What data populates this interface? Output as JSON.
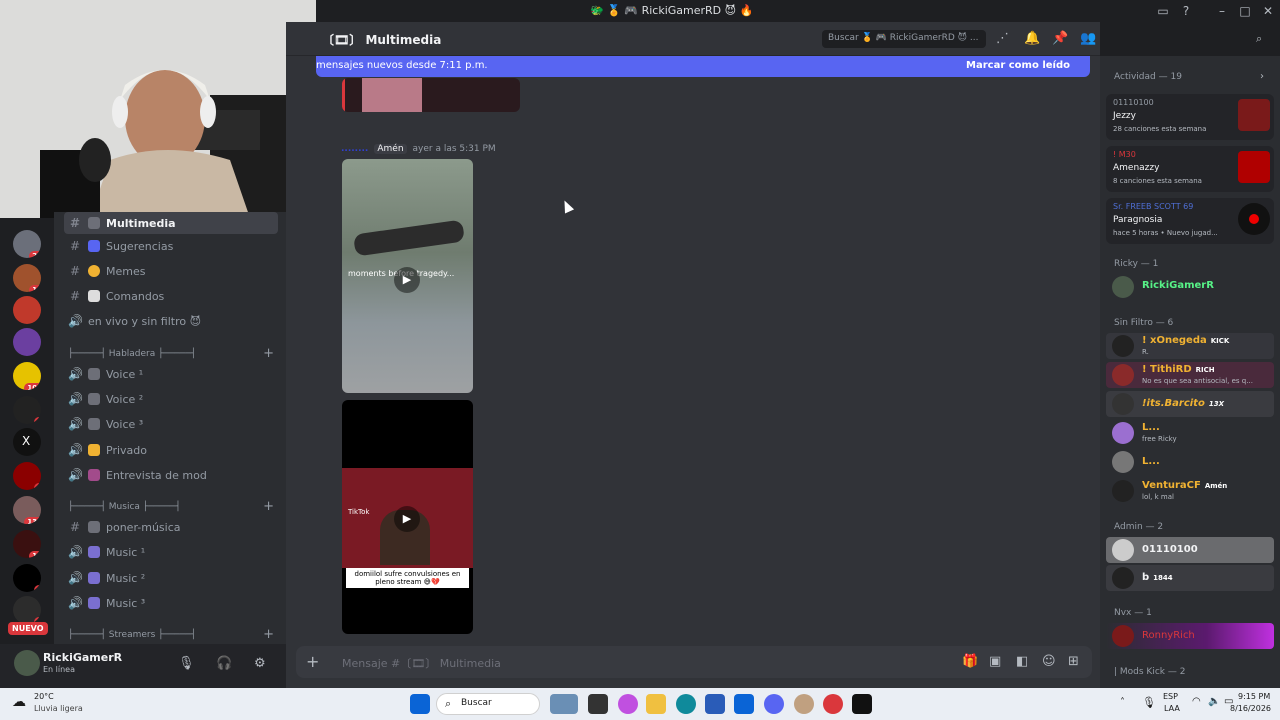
{
  "titlebar": {
    "title": "🐲 🏅 🎮 RickiGamerRD 😈 🔥",
    "icons": [
      "inbox-icon",
      "help-icon",
      "minimize-icon",
      "maximize-icon",
      "close-icon"
    ]
  },
  "channel": {
    "name": "Multimedia",
    "prefix": "〔🎞〕"
  },
  "header": {
    "search_placeholder": "Buscar 🏅 🎮 RickiGamerRD 😈 ..."
  },
  "new_messages": {
    "text": "mensajes nuevos desde 7:11 p.m.",
    "mark_read": "Marcar como leído"
  },
  "message": {
    "author": "........",
    "tag": "Amén",
    "time": "ayer a las 5:31 PM"
  },
  "media": {
    "video1_caption": "moments before tragedy...",
    "video2_caption": "domiilol sufre convulsiones en pleno stream 😅💔",
    "tiktok": "TikTok"
  },
  "composer": {
    "placeholder_prefix": "Mensaje #〔🎞〕",
    "placeholder_channel": "Multimedia"
  },
  "sidebar": {
    "channels": [
      {
        "label": "Multimedia",
        "icon": "#",
        "active": true
      },
      {
        "label": "Sugerencias",
        "icon": "#"
      },
      {
        "label": "Memes",
        "icon": "#"
      },
      {
        "label": "Comandos",
        "icon": "#"
      },
      {
        "label": "en vivo y sin filtro 😈",
        "icon": "🔊"
      }
    ],
    "cat_habladera": "├─────┤ Habladera ├─────┤",
    "voice": [
      {
        "label": "Voice ¹"
      },
      {
        "label": "Voice ²"
      },
      {
        "label": "Voice ³"
      },
      {
        "label": "Privado"
      },
      {
        "label": "Entrevista de mod"
      }
    ],
    "cat_musica": "├─────┤ Musica ├─────┤",
    "musica": [
      {
        "label": "poner-música",
        "icon": "#"
      },
      {
        "label": "Music ¹",
        "icon": "🔊"
      },
      {
        "label": "Music ²",
        "icon": "🔊"
      },
      {
        "label": "Music ³",
        "icon": "🔊"
      }
    ],
    "cat_streamers": "├─────┤ Streamers ├─────┤",
    "guild_badges": [
      "20",
      "12",
      "109",
      "9",
      "2",
      "134",
      "13",
      "8",
      "3"
    ],
    "nuevo": "NUEVO"
  },
  "user": {
    "name": "RickiGamerR",
    "status": "En línea"
  },
  "members": {
    "activity_header": "Actividad — 19",
    "activities": [
      {
        "game": "01110100",
        "name": "Jezzy",
        "sub": "28 canciones esta semana"
      },
      {
        "game": "! M30",
        "name": "Amenazzy",
        "sub": "8 canciones esta semana"
      },
      {
        "game": "Sr. FREEB SCOTT 69",
        "name": "Paragnosia",
        "sub": "hace 5 horas  •  Nuevo jugad..."
      }
    ],
    "ricky_header": "Ricky — 1",
    "ricky": [
      {
        "name": "RickiGamerR"
      }
    ],
    "sinfiltro_header": "Sin Filtro — 6",
    "sinfiltro": [
      {
        "name": "! xOnegeda",
        "badge": "KICK",
        "sub": "R.",
        "color": "#f0b232"
      },
      {
        "name": "! TithiRD",
        "badge": "RICH",
        "sub": "No es que sea antisocial, es q...",
        "color": "#f0b232"
      },
      {
        "name": "!its.Barcito",
        "badge": "13X",
        "sub": "",
        "color": "#f0b232"
      },
      {
        "name": "L...",
        "badge": "",
        "sub": "free Ricky",
        "color": "#f0b232"
      },
      {
        "name": "L...",
        "badge": "",
        "sub": "",
        "color": "#f0b232"
      },
      {
        "name": "VenturaCF",
        "badge": "Amén",
        "sub": "lol, k mal",
        "color": "#f0b232"
      }
    ],
    "admin_header": "Admin — 2",
    "admin": [
      {
        "name": "01110100",
        "badge": "",
        "sub": ""
      },
      {
        "name": "b",
        "badge": "1844",
        "sub": ""
      }
    ],
    "nvx_header": "Nvx — 1",
    "nvx": [
      {
        "name": "RonnyRich"
      }
    ],
    "modskick_header": "| Mods Kick — 2"
  },
  "taskbar": {
    "weather_temp": "20°C",
    "weather_text": "Lluvia ligera",
    "search": "Buscar",
    "lang": "ESP",
    "lang2": "LAA",
    "time": "9:15 PM",
    "date": "8/16/2026"
  }
}
